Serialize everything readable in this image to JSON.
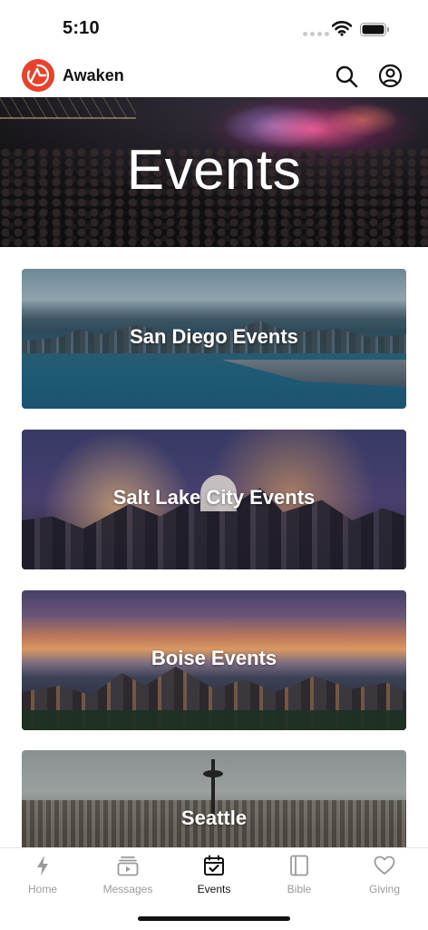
{
  "status_bar": {
    "time": "5:10"
  },
  "header": {
    "app_name": "Awaken",
    "logo_icon": "awaken-logo-icon",
    "search_icon": "search-icon",
    "account_icon": "account-icon",
    "brand_color": "#e8422c"
  },
  "hero": {
    "title": "Events"
  },
  "events": [
    {
      "label": "San Diego Events"
    },
    {
      "label": "Salt Lake City Events"
    },
    {
      "label": "Boise Events"
    },
    {
      "label": "Seattle"
    }
  ],
  "tabs": [
    {
      "label": "Home",
      "icon": "lightning-icon",
      "active": false
    },
    {
      "label": "Messages",
      "icon": "video-stack-icon",
      "active": false
    },
    {
      "label": "Events",
      "icon": "calendar-check-icon",
      "active": true
    },
    {
      "label": "Bible",
      "icon": "book-icon",
      "active": false
    },
    {
      "label": "Giving",
      "icon": "heart-icon",
      "active": false
    }
  ],
  "colors": {
    "active_tab": "#111111",
    "inactive_tab": "#9a9a9a"
  }
}
